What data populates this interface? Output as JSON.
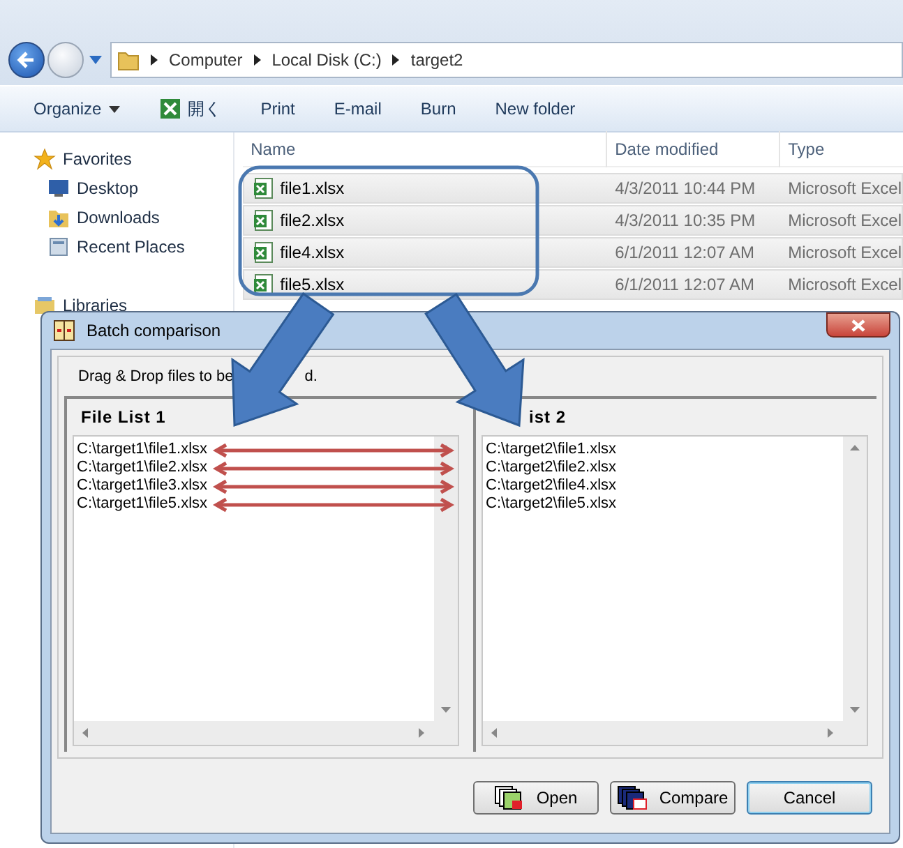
{
  "explorer": {
    "breadcrumb": [
      "Computer",
      "Local Disk (C:)",
      "target2"
    ],
    "toolbar": [
      {
        "label": "Organize",
        "kind": "menu"
      },
      {
        "label": "開く",
        "kind": "excel"
      },
      {
        "label": "Print",
        "kind": "plain"
      },
      {
        "label": "E-mail",
        "kind": "plain"
      },
      {
        "label": "Burn",
        "kind": "plain"
      },
      {
        "label": "New folder",
        "kind": "plain"
      }
    ],
    "sidebar": [
      {
        "label": "Favorites",
        "kind": "star"
      },
      {
        "label": "Desktop",
        "kind": "desktop"
      },
      {
        "label": "Downloads",
        "kind": "downloads"
      },
      {
        "label": "Recent Places",
        "kind": "recent"
      },
      {
        "label": "Libraries",
        "kind": "libraries"
      }
    ],
    "columns": [
      "Name",
      "Date modified",
      "Type"
    ],
    "files": [
      {
        "name": "file1.xlsx",
        "date": "4/3/2011 10:44 PM",
        "type": "Microsoft Excel"
      },
      {
        "name": "file2.xlsx",
        "date": "4/3/2011 10:35 PM",
        "type": "Microsoft Excel"
      },
      {
        "name": "file4.xlsx",
        "date": "6/1/2011 12:07 AM",
        "type": "Microsoft Excel"
      },
      {
        "name": "file5.xlsx",
        "date": "6/1/2011 12:07 AM",
        "type": "Microsoft Excel"
      }
    ]
  },
  "dialog": {
    "title": "Batch comparison",
    "hint": "Drag & Drop files to be",
    "hint_tail": "d.",
    "lists": [
      {
        "title": "File List 1",
        "items": [
          "C:\\target1\\file1.xlsx",
          "C:\\target1\\file2.xlsx",
          "C:\\target1\\file3.xlsx",
          "C:\\target1\\file5.xlsx"
        ]
      },
      {
        "title": "ist 2",
        "items": [
          "C:\\target2\\file1.xlsx",
          "C:\\target2\\file2.xlsx",
          "C:\\target2\\file4.xlsx",
          "C:\\target2\\file5.xlsx"
        ]
      }
    ],
    "buttons": [
      {
        "label": "Open",
        "kind": "open"
      },
      {
        "label": "Compare",
        "kind": "compare"
      },
      {
        "label": "Cancel",
        "kind": "default"
      }
    ]
  }
}
